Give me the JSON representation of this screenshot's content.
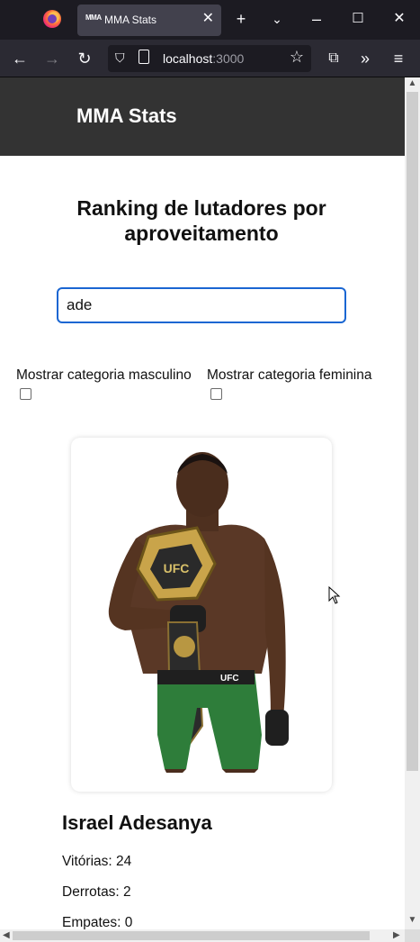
{
  "browser": {
    "tab_favicon": "MMA",
    "tab_title": "MMA Stats",
    "url_host": "localhost",
    "url_port": ":3000"
  },
  "header": {
    "title": "MMA Stats"
  },
  "main": {
    "heading": "Ranking de lutadores por aproveitamento",
    "search": {
      "value": "ade",
      "placeholder": ""
    },
    "filters": [
      {
        "label": "Mostrar categoria masculino",
        "checked": false
      },
      {
        "label": "Mostrar categoria feminina",
        "checked": false
      }
    ]
  },
  "fighter": {
    "name": "Israel Adesanya",
    "stats": [
      {
        "label": "Vitórias: 24"
      },
      {
        "label": "Derrotas: 2"
      },
      {
        "label": "Empates: 0"
      }
    ]
  },
  "icons": {
    "back": "arrow-left-icon",
    "forward": "arrow-right-icon",
    "reload": "reload-icon",
    "shield": "shield-icon",
    "star": "star-icon"
  },
  "colors": {
    "header_bg": "#333333",
    "search_border": "#1a66d2",
    "belt_gold": "#c9a44a",
    "shorts_green": "#2e7d3a"
  }
}
